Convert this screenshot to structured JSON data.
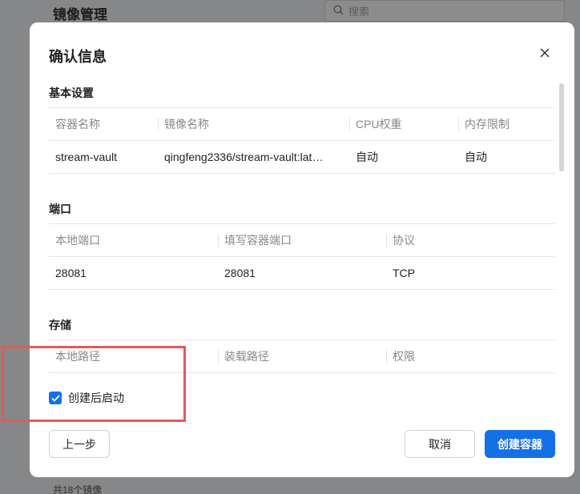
{
  "background": {
    "page_title": "镜像管理",
    "search_placeholder": "搜索",
    "footer_text": "共18个镜像"
  },
  "modal": {
    "title": "确认信息",
    "sections": {
      "basic": {
        "title": "基本设置",
        "columns": [
          "容器名称",
          "镜像名称",
          "CPU权重",
          "内存限制"
        ],
        "rows": [
          [
            "stream-vault",
            "qingfeng2336/stream-vault:lat…",
            "自动",
            "自动"
          ]
        ]
      },
      "ports": {
        "title": "端口",
        "columns": [
          "本地端口",
          "填写容器端口",
          "协议"
        ],
        "rows": [
          [
            "28081",
            "28081",
            "TCP"
          ]
        ]
      },
      "storage": {
        "title": "存储",
        "columns": [
          "本地路径",
          "装载路径",
          "权限"
        ]
      }
    },
    "checkbox": {
      "label": "创建后启动",
      "checked": true
    },
    "buttons": {
      "prev": "上一步",
      "cancel": "取消",
      "create": "创建容器"
    }
  },
  "colors": {
    "primary": "#1470e6",
    "annotation": "#e15a5a"
  }
}
